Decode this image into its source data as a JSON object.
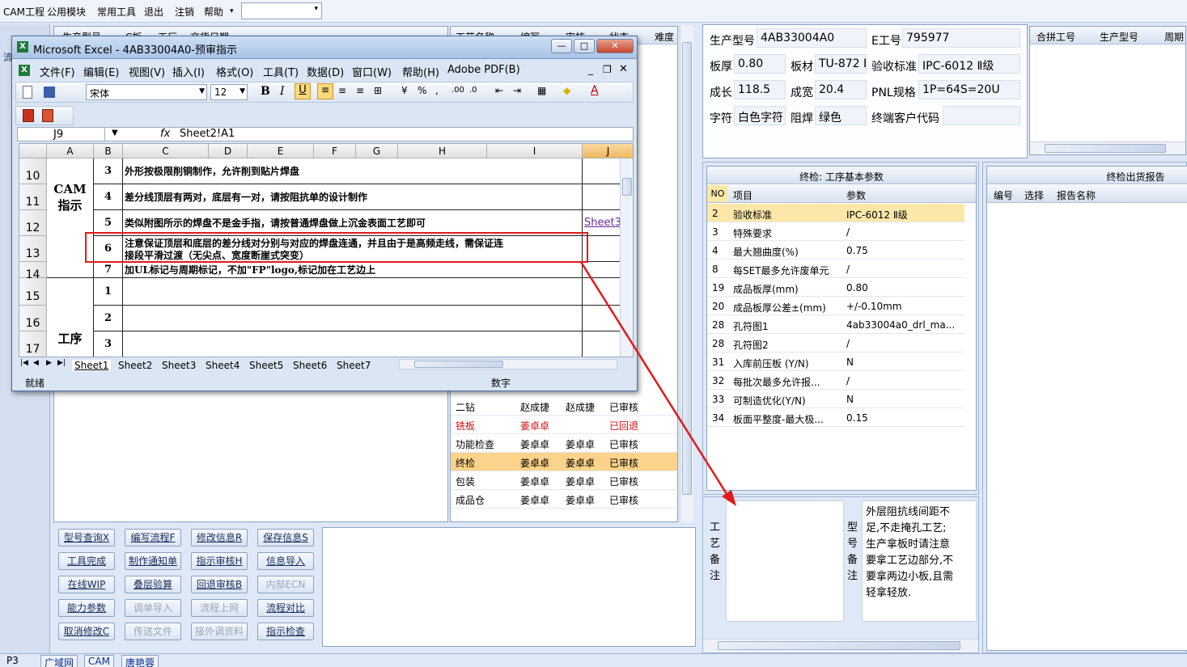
{
  "menubar": {
    "items": [
      "CAM工程",
      "公用模块",
      "常用工具",
      "退出",
      "注销",
      "帮助"
    ],
    "arrow": "▾"
  },
  "left_grid": {
    "headers": [
      "生产型号",
      "C板",
      "工厂",
      "交货日期"
    ],
    "left_tab": "流"
  },
  "process_grid": {
    "headers": [
      "工艺名称",
      "编写",
      "审核",
      "状态",
      "难度"
    ],
    "rows": [
      {
        "name": "二钻",
        "writer": "赵成捷",
        "reviewer": "赵成捷",
        "status": "已审核",
        "red": false,
        "selected": false
      },
      {
        "name": "铣板",
        "writer": "姜卓卓",
        "reviewer": "",
        "status": "已回退",
        "red": true,
        "selected": false
      },
      {
        "name": "功能检查",
        "writer": "姜卓卓",
        "reviewer": "姜卓卓",
        "status": "已审核",
        "red": false,
        "selected": false
      },
      {
        "name": "终检",
        "writer": "姜卓卓",
        "reviewer": "姜卓卓",
        "status": "已审核",
        "red": false,
        "selected": true
      },
      {
        "name": "包装",
        "writer": "姜卓卓",
        "reviewer": "姜卓卓",
        "status": "已审核",
        "red": false,
        "selected": false
      },
      {
        "name": "成品仓",
        "writer": "姜卓卓",
        "reviewer": "姜卓卓",
        "status": "已审核",
        "red": false,
        "selected": false
      }
    ]
  },
  "buttons": [
    {
      "label": "型号查询X",
      "enabled": true
    },
    {
      "label": "编写流程F",
      "enabled": true
    },
    {
      "label": "修改信息R",
      "enabled": true
    },
    {
      "label": "保存信息S",
      "enabled": true
    },
    {
      "label": "工具完成",
      "enabled": true
    },
    {
      "label": "制作通知单",
      "enabled": true
    },
    {
      "label": "指示审核H",
      "enabled": true
    },
    {
      "label": "信息导入",
      "enabled": true
    },
    {
      "label": "在线WIP",
      "enabled": true
    },
    {
      "label": "叠层验算",
      "enabled": true
    },
    {
      "label": "回退审核B",
      "enabled": true
    },
    {
      "label": "内部ECN",
      "enabled": false
    },
    {
      "label": "能力参数",
      "enabled": true
    },
    {
      "label": "调单导入",
      "enabled": false
    },
    {
      "label": "流程上网",
      "enabled": false
    },
    {
      "label": "流程对比",
      "enabled": true
    },
    {
      "label": "取消修改C",
      "enabled": true
    },
    {
      "label": "传送文件",
      "enabled": false
    },
    {
      "label": "接外调资料",
      "enabled": false
    },
    {
      "label": "指示检查",
      "enabled": true
    }
  ],
  "info": {
    "model_label": "生产型号",
    "model": "4AB33004A0",
    "eno_label": "E工号",
    "eno": "795977",
    "thickness_label": "板厚",
    "thickness": "0.80",
    "material_label": "板材",
    "material": "TU-872 L",
    "accept_label": "验收标准",
    "accept": "IPC-6012 Ⅱ级",
    "length_label": "成长",
    "length": "118.5",
    "width_label": "成宽",
    "width": "20.4",
    "pnl_label": "PNL规格",
    "pnl": "1P=64S=20U",
    "char_label": "字符",
    "char": "白色字符",
    "mask_label": "阻焊",
    "mask": "绿色",
    "customer_label": "终端客户代码",
    "customer": ""
  },
  "merge_grid": {
    "headers": [
      "合拼工号",
      "生产型号",
      "周期"
    ]
  },
  "params": {
    "title": "终检: 工序基本参数",
    "headers": [
      "NO",
      "项目",
      "参数"
    ],
    "rows": [
      {
        "no": "2",
        "item": "验收标准",
        "value": "IPC-6012 Ⅱ级"
      },
      {
        "no": "3",
        "item": "特殊要求",
        "value": "/"
      },
      {
        "no": "4",
        "item": "最大翘曲度(%)",
        "value": "0.75"
      },
      {
        "no": "8",
        "item": "每SET最多允许废单元",
        "value": "/"
      },
      {
        "no": "19",
        "item": "成品板厚(mm)",
        "value": "0.80"
      },
      {
        "no": "20",
        "item": "成品板厚公差±(mm)",
        "value": "+/-0.10mm"
      },
      {
        "no": "28",
        "item": "孔符图1",
        "value": "4ab33004a0_drl_ma..."
      },
      {
        "no": "28",
        "item": "孔符图2",
        "value": "/"
      },
      {
        "no": "31",
        "item": "入库前压板 (Y/N)",
        "value": "N"
      },
      {
        "no": "32",
        "item": "每批次最多允许报...",
        "value": "/"
      },
      {
        "no": "33",
        "item": "可制造优化(Y/N)",
        "value": "N"
      },
      {
        "no": "34",
        "item": "板面平整度-最大极...",
        "value": "0.15"
      }
    ]
  },
  "report": {
    "title": "终检出货报告",
    "headers": [
      "编号",
      "选择",
      "报告名称"
    ]
  },
  "remarks": {
    "process_label": [
      "工",
      "艺",
      "备",
      "注"
    ],
    "model_label": [
      "型",
      "号",
      "备",
      "注"
    ],
    "model_text": [
      "外层阻抗线间距不",
      "足,不走掩孔工艺;",
      "生产拿板时请注意",
      "要拿工艺边部分,不",
      "要拿两边小板,且需",
      "轻拿轻放."
    ]
  },
  "excel": {
    "title": "Microsoft Excel - 4AB33004A0-预审指示",
    "menu": [
      "文件(F)",
      "编辑(E)",
      "视图(V)",
      "插入(I)",
      "格式(O)",
      "工具(T)",
      "数据(D)",
      "窗口(W)",
      "帮助(H)",
      "Adobe PDF(B)"
    ],
    "font": "宋体",
    "size": "12",
    "namebox": "J9",
    "fx": "fx",
    "formula": "Sheet2!A1",
    "cols": [
      "A",
      "B",
      "C",
      "D",
      "E",
      "F",
      "G",
      "H",
      "I",
      "J"
    ],
    "rows": [
      {
        "r": "10",
        "b": "3",
        "text": "外形按极限削铜制作，允许削到贴片焊盘"
      },
      {
        "r": "11",
        "b": "4",
        "text": "差分线顶层有两对，底层有一对，请按阻抗单的设计制作"
      },
      {
        "r": "12",
        "b": "5",
        "text": "类似附图所示的焊盘不是金手指，请按普通焊盘做上沉金表面工艺即可"
      },
      {
        "r": "13",
        "b": "6",
        "text": "注意保证顶层和底层的差分线对分别与对应的焊盘连通，并且由于是高频走线，需保证连",
        "text2": "接段平滑过渡（无尖点、宽度断崖式突变）"
      },
      {
        "r": "14",
        "b": "7",
        "text": "加UL标记与周期标记，不加\"FP\"logo,标记加在工艺边上"
      },
      {
        "r": "15",
        "b": "1",
        "text": ""
      },
      {
        "r": "16",
        "b": "2",
        "text": ""
      },
      {
        "r": "17",
        "b": "3",
        "text": ""
      }
    ],
    "merged_a": "CAM\n指示",
    "merged_a2": "工序",
    "link": "Sheet3",
    "tabs": [
      "Sheet1",
      "Sheet2",
      "Sheet3",
      "Sheet4",
      "Sheet5",
      "Sheet6",
      "Sheet7"
    ],
    "status_left": "就绪",
    "status_mid": "数字"
  },
  "bottombar": {
    "items": [
      "广域网",
      "CAM",
      "唐艳蓉"
    ],
    "left": "P3"
  }
}
